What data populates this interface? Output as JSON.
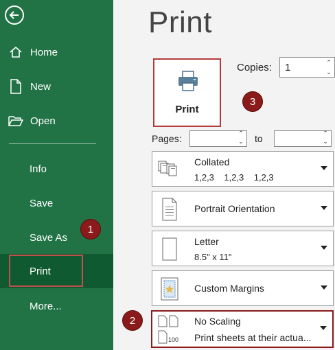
{
  "sidebar": {
    "items": [
      {
        "label": "Home"
      },
      {
        "label": "New"
      },
      {
        "label": "Open"
      },
      {
        "label": "Info"
      },
      {
        "label": "Save"
      },
      {
        "label": "Save As"
      },
      {
        "label": "Print"
      },
      {
        "label": "More..."
      }
    ]
  },
  "main": {
    "title": "Print",
    "print_button_label": "Print",
    "copies_label": "Copies:",
    "copies_value": "1",
    "pages_label": "Pages:",
    "to_label": "to",
    "settings": [
      {
        "line1": "Collated",
        "line2": "1,2,3    1,2,3    1,2,3"
      },
      {
        "line1": "Portrait Orientation"
      },
      {
        "line1": "Letter",
        "line2": "8.5\" x 11\""
      },
      {
        "line1": "Custom Margins"
      },
      {
        "line1": "No Scaling",
        "line2": "Print sheets at their actua..."
      }
    ]
  },
  "badges": [
    "1",
    "2",
    "3"
  ],
  "colors": {
    "sidebar": "#217346",
    "sidebar_selected": "#0f5a30",
    "highlight": "#b23a3a",
    "badge": "#8b1a1a"
  }
}
